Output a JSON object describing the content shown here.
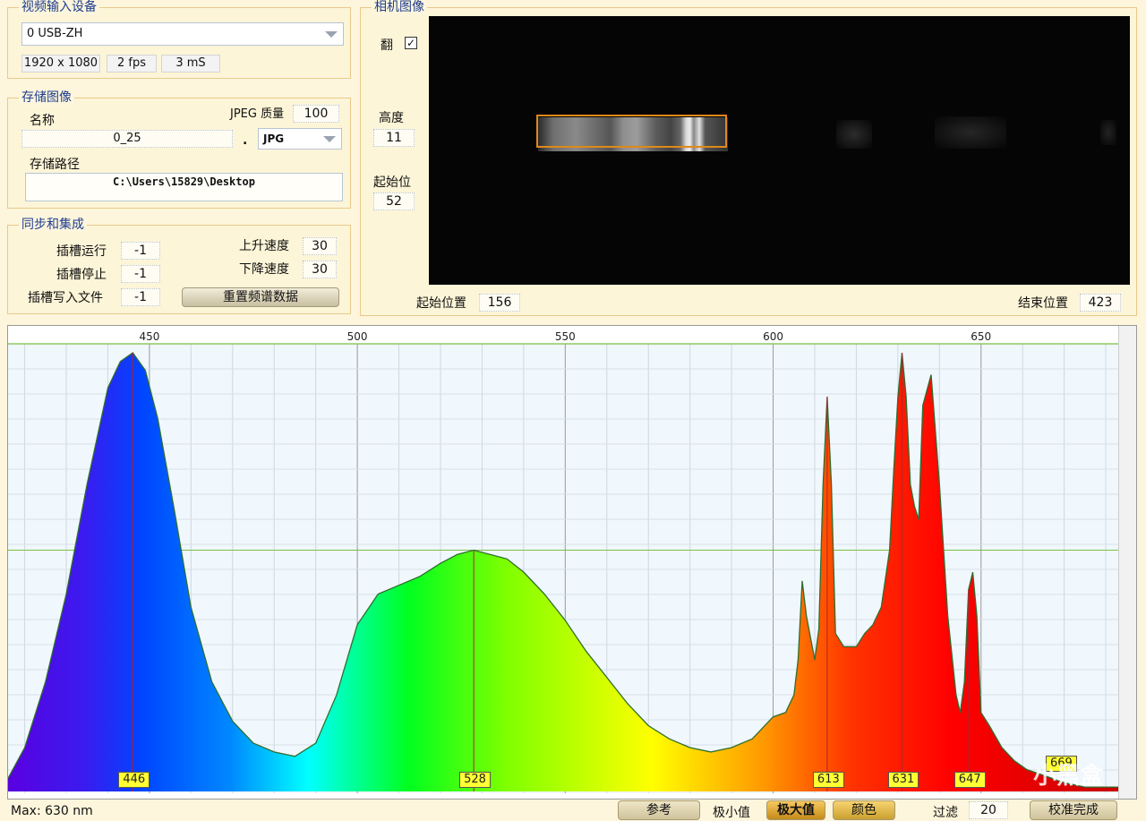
{
  "video_group": {
    "title": "视频输入设备",
    "device": "0 USB-ZH",
    "resolution": "1920 x 1080",
    "fps": "2 fps",
    "exposure": "3 mS"
  },
  "save_group": {
    "title": "存储图像",
    "name_label": "名称",
    "jpeg_quality_label": "JPEG 质量",
    "jpeg_quality": "100",
    "file_name": "0_25",
    "dot": ".",
    "format": "JPG",
    "path_label": "存储路径",
    "path": "C:\\Users\\15829\\Desktop"
  },
  "sync_group": {
    "title": "同步和集成",
    "slot_run_label": "插槽运行",
    "slot_run": "-1",
    "slot_stop_label": "插槽停止",
    "slot_stop": "-1",
    "slot_write_label": "插槽写入文件",
    "slot_write": "-1",
    "rise_speed_label": "上升速度",
    "rise_speed": "30",
    "fall_speed_label": "下降速度",
    "fall_speed": "30",
    "reset_button": "重置频谱数据"
  },
  "camera_group": {
    "title": "相机图像",
    "flip_label": "翻",
    "flip_checked": "✓",
    "height_label": "高度",
    "height": "11",
    "start_label": "起始位",
    "start": "52",
    "start_pos_label": "起始位置",
    "start_pos": "156",
    "end_pos_label": "结束位置",
    "end_pos": "423"
  },
  "spectrum": {
    "x_ticks": [
      "450",
      "500",
      "550",
      "600",
      "650"
    ],
    "peak_labels": [
      "446",
      "528",
      "613",
      "631",
      "647",
      "669"
    ],
    "max_text": "Max: 630 nm"
  },
  "bottom_bar": {
    "reference": "参考",
    "min_value": "极小值",
    "max_value": "极大值",
    "color": "颜色",
    "filter_label": "过滤",
    "filter_value": "20",
    "calibrate_done": "校准完成"
  },
  "watermark": "小黑盒",
  "chart_data": {
    "type": "area",
    "x_unit": "nm",
    "xlim": [
      416,
      683
    ],
    "x": [
      416,
      420,
      425,
      430,
      435,
      440,
      443,
      446,
      449,
      452,
      456,
      460,
      465,
      470,
      475,
      480,
      485,
      490,
      495,
      500,
      505,
      510,
      515,
      520,
      524,
      528,
      532,
      536,
      540,
      545,
      550,
      555,
      560,
      565,
      570,
      575,
      580,
      585,
      590,
      595,
      600,
      603,
      605,
      606,
      607,
      608,
      610,
      611,
      612,
      613,
      614,
      615,
      617,
      620,
      622,
      624,
      626,
      628,
      629,
      630,
      631,
      632,
      633,
      634,
      635,
      636,
      638,
      640,
      642,
      644,
      645,
      646,
      647,
      648,
      649,
      650,
      652,
      655,
      658,
      661,
      664,
      667,
      670,
      675,
      683
    ],
    "y": [
      3,
      10,
      25,
      45,
      70,
      92,
      98,
      100,
      96,
      85,
      64,
      42,
      25,
      16,
      11,
      9,
      8,
      11,
      22,
      38,
      45,
      47,
      49,
      52,
      54,
      55,
      54,
      53,
      50,
      45,
      39,
      32,
      26,
      20,
      15,
      12,
      10,
      9,
      10,
      12,
      17,
      18,
      22,
      30,
      48,
      40,
      30,
      37,
      70,
      90,
      70,
      36,
      33,
      33,
      36,
      38,
      42,
      55,
      73,
      90,
      100,
      90,
      70,
      65,
      62,
      88,
      95,
      70,
      40,
      22,
      18,
      25,
      46,
      50,
      40,
      18,
      15,
      10,
      7,
      5,
      4,
      3,
      2,
      1,
      1
    ],
    "peaks": [
      446,
      528,
      613,
      631,
      647,
      669
    ]
  }
}
